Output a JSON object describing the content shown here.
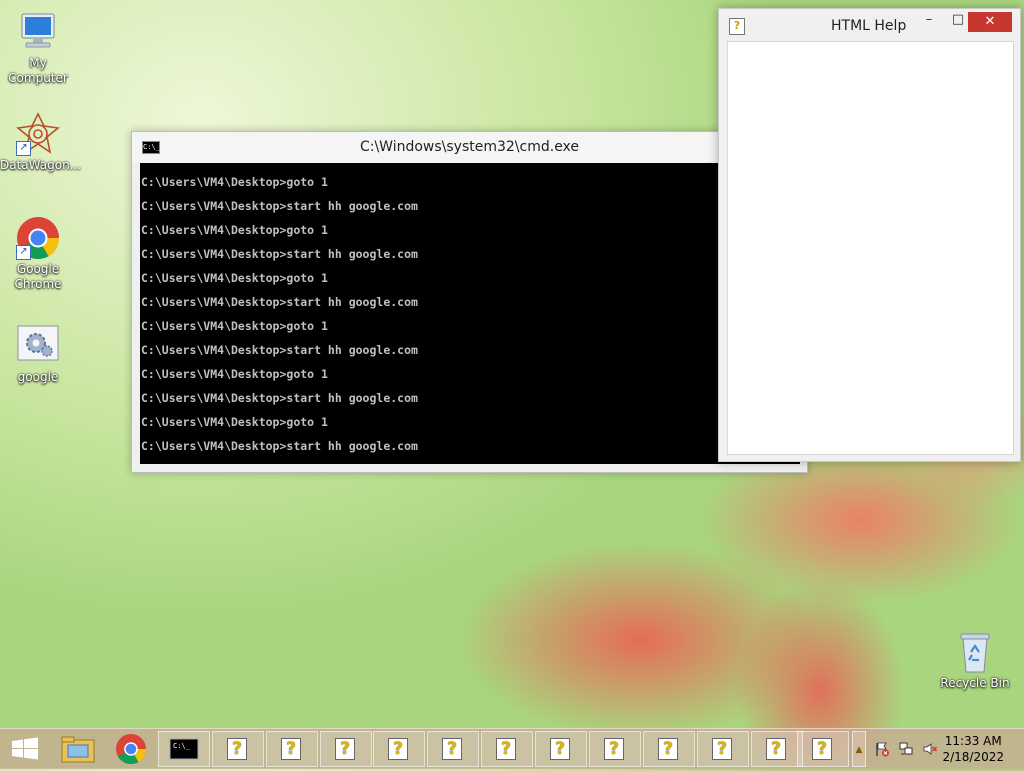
{
  "desktop": {
    "icons": [
      {
        "label": "My Computer",
        "icon": "computer-icon"
      },
      {
        "label": "DataWagon...",
        "icon": "datawagon-icon"
      },
      {
        "label": "Google Chrome",
        "icon": "chrome-icon"
      },
      {
        "label": "google",
        "icon": "settings-file-icon"
      },
      {
        "label": "Recycle Bin",
        "icon": "recycle-bin-icon"
      }
    ]
  },
  "cmd_window": {
    "title": "C:\\Windows\\system32\\cmd.exe",
    "icon_text": "C:\\_",
    "minimize_glyph": "–",
    "lines": [
      "C:\\Users\\VM4\\Desktop>goto 1",
      "C:\\Users\\VM4\\Desktop>start hh google.com",
      "C:\\Users\\VM4\\Desktop>goto 1",
      "C:\\Users\\VM4\\Desktop>start hh google.com",
      "C:\\Users\\VM4\\Desktop>goto 1",
      "C:\\Users\\VM4\\Desktop>start hh google.com",
      "C:\\Users\\VM4\\Desktop>goto 1",
      "C:\\Users\\VM4\\Desktop>start hh google.com",
      "C:\\Users\\VM4\\Desktop>goto 1",
      "C:\\Users\\VM4\\Desktop>start hh google.com",
      "C:\\Users\\VM4\\Desktop>goto 1",
      "C:\\Users\\VM4\\Desktop>start hh google.com"
    ]
  },
  "help_window": {
    "title": "HTML Help",
    "icon_glyph": "?",
    "minimize_glyph": "–",
    "maximize_glyph": "□",
    "close_glyph": "✕"
  },
  "taskbar": {
    "start_icon": "windows-logo-icon",
    "pinned": [
      "file-explorer-icon",
      "chrome-icon",
      "cmd-icon"
    ],
    "help_windows_count": 11,
    "help_glyph": "?",
    "overflow_glyph": "▲",
    "tray_icons": [
      "action-center-flag-icon",
      "network-icon",
      "volume-muted-icon"
    ],
    "clock": {
      "time": "11:33 AM",
      "date": "2/18/2022"
    }
  },
  "colors": {
    "console_bg": "#000000",
    "console_text": "#c0c0c0",
    "close_button": "#c7372f"
  }
}
